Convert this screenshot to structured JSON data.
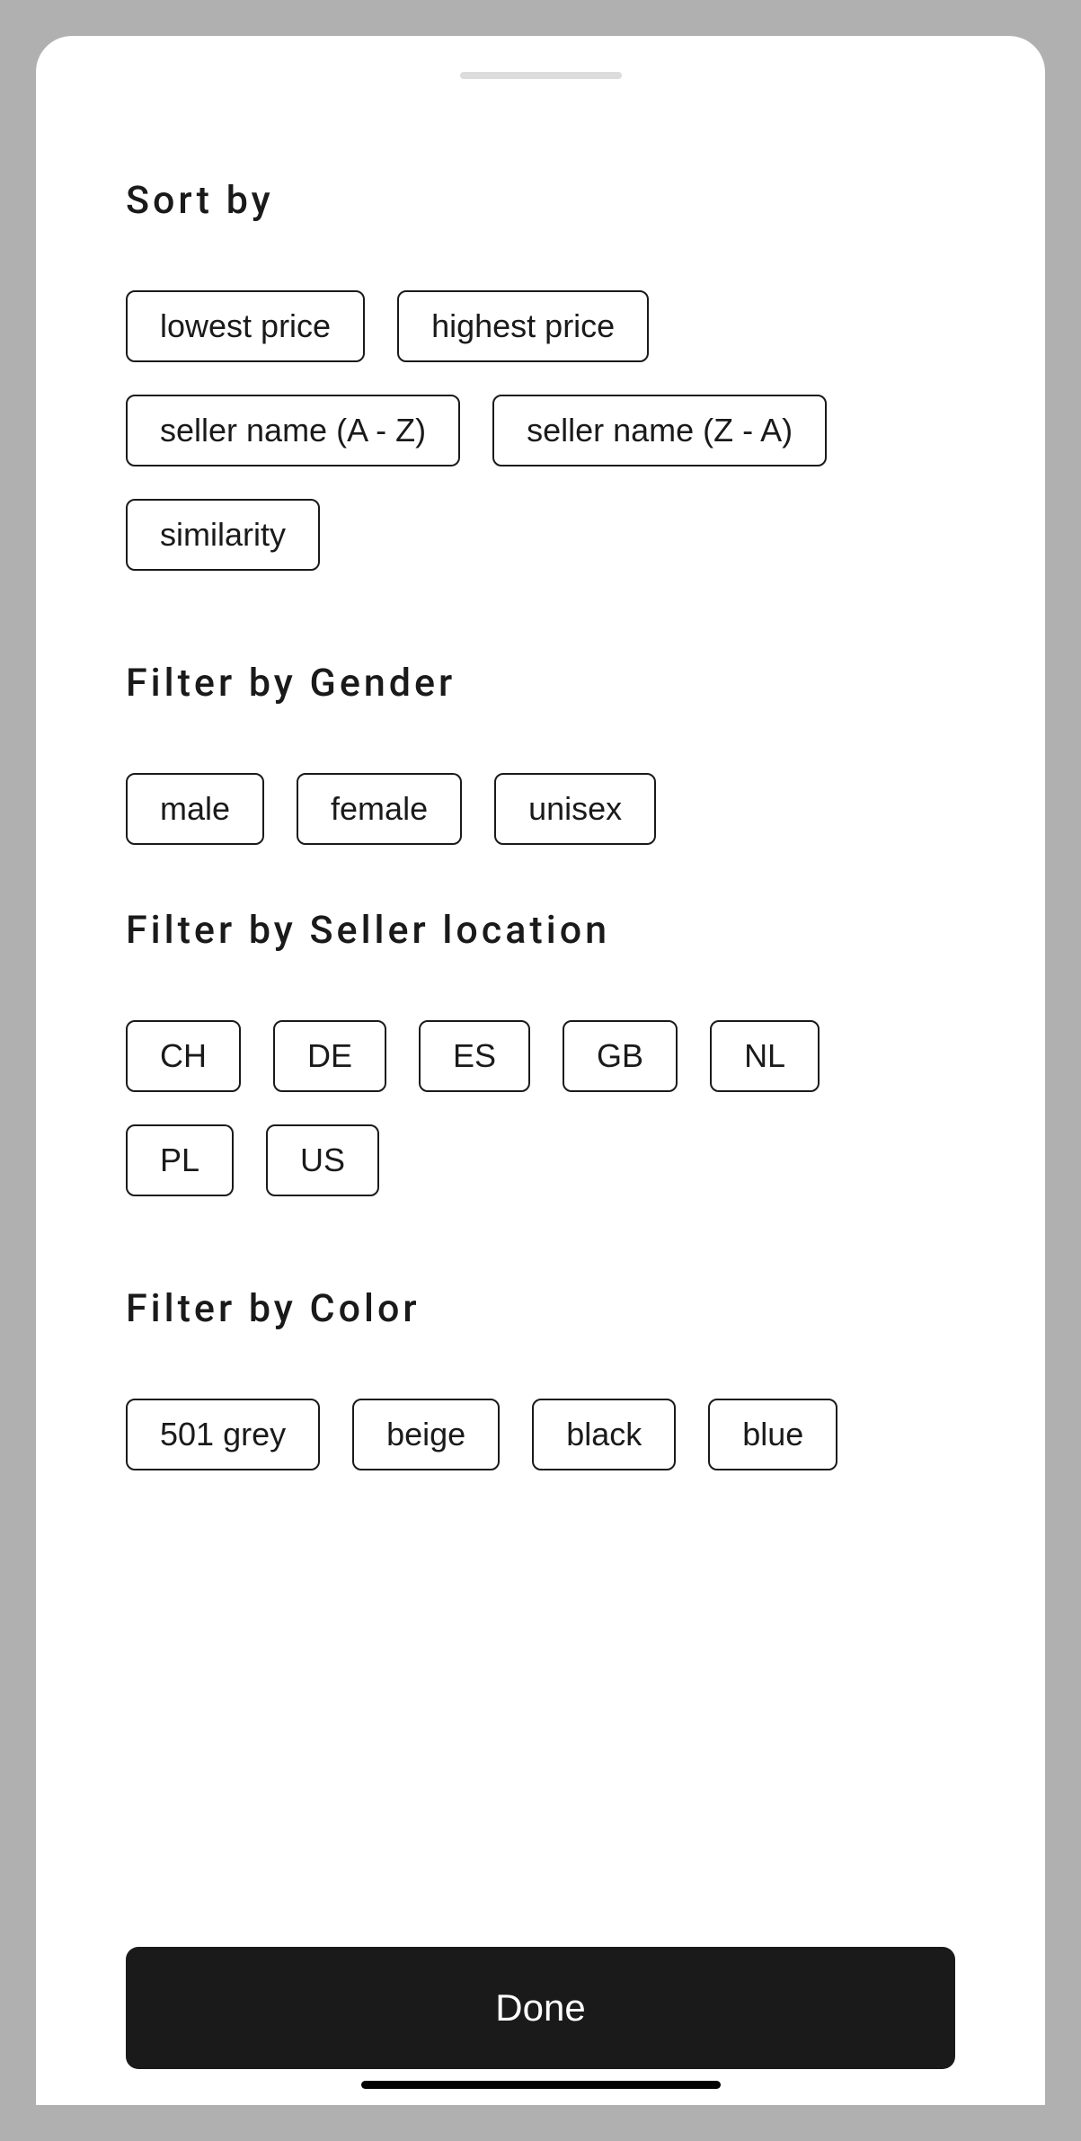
{
  "sections": {
    "sort": {
      "heading": "Sort by",
      "options": [
        "lowest price",
        "highest price",
        "seller name (A - Z)",
        "seller name (Z - A)",
        "similarity"
      ]
    },
    "gender": {
      "heading": "Filter by Gender",
      "options": [
        "male",
        "female",
        "unisex"
      ]
    },
    "location": {
      "heading": "Filter by Seller location",
      "options": [
        "CH",
        "DE",
        "ES",
        "GB",
        "NL",
        "PL",
        "US"
      ]
    },
    "color": {
      "heading": "Filter by Color",
      "options": [
        "501 grey",
        "beige",
        "black",
        "blue"
      ]
    }
  },
  "done_label": "Done"
}
